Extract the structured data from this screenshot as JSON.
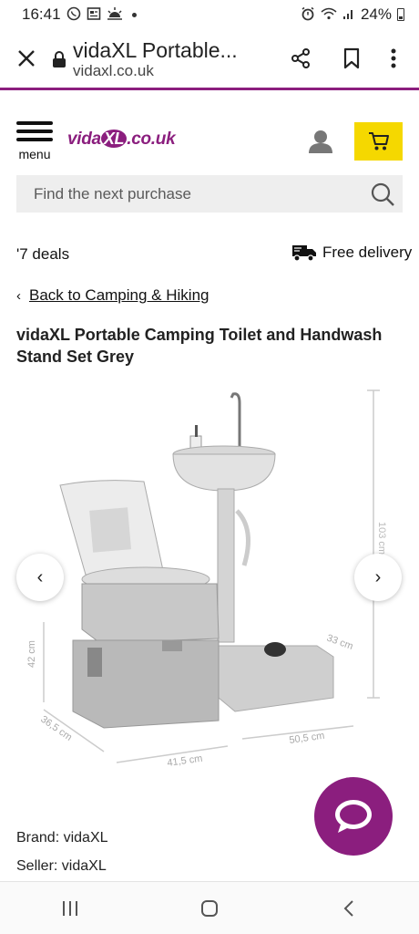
{
  "status_bar": {
    "time": "16:41",
    "battery": "24%"
  },
  "browser": {
    "page_title": "vidaXL Portable...",
    "domain": "vidaxl.co.uk"
  },
  "header": {
    "menu_label": "menu",
    "logo_prefix": "vida",
    "logo_xl": "XL",
    "logo_suffix": ".co.uk"
  },
  "search": {
    "placeholder": "Find the next purchase"
  },
  "promo": {
    "deals": "'7 deals",
    "delivery": "Free delivery"
  },
  "breadcrumb": {
    "chevron": "‹",
    "back_label": "Back to Camping & Hiking"
  },
  "product": {
    "title": "vidaXL Portable Camping Toilet and Handwash Stand Set Grey",
    "dimensions": {
      "height": "103 cm",
      "toilet_height": "42 cm",
      "toilet_depth": "36,5 cm",
      "toilet_width": "41,5 cm",
      "stand_depth": "33 cm",
      "stand_width": "50,5 cm"
    },
    "brand_label": "Brand: vidaXL",
    "seller_label": "Seller: vidaXL"
  },
  "carousel": {
    "prev_symbol": "‹",
    "next_symbol": "›"
  },
  "colors": {
    "brand_purple": "#8b1e7e",
    "cart_yellow": "#f5d800"
  }
}
